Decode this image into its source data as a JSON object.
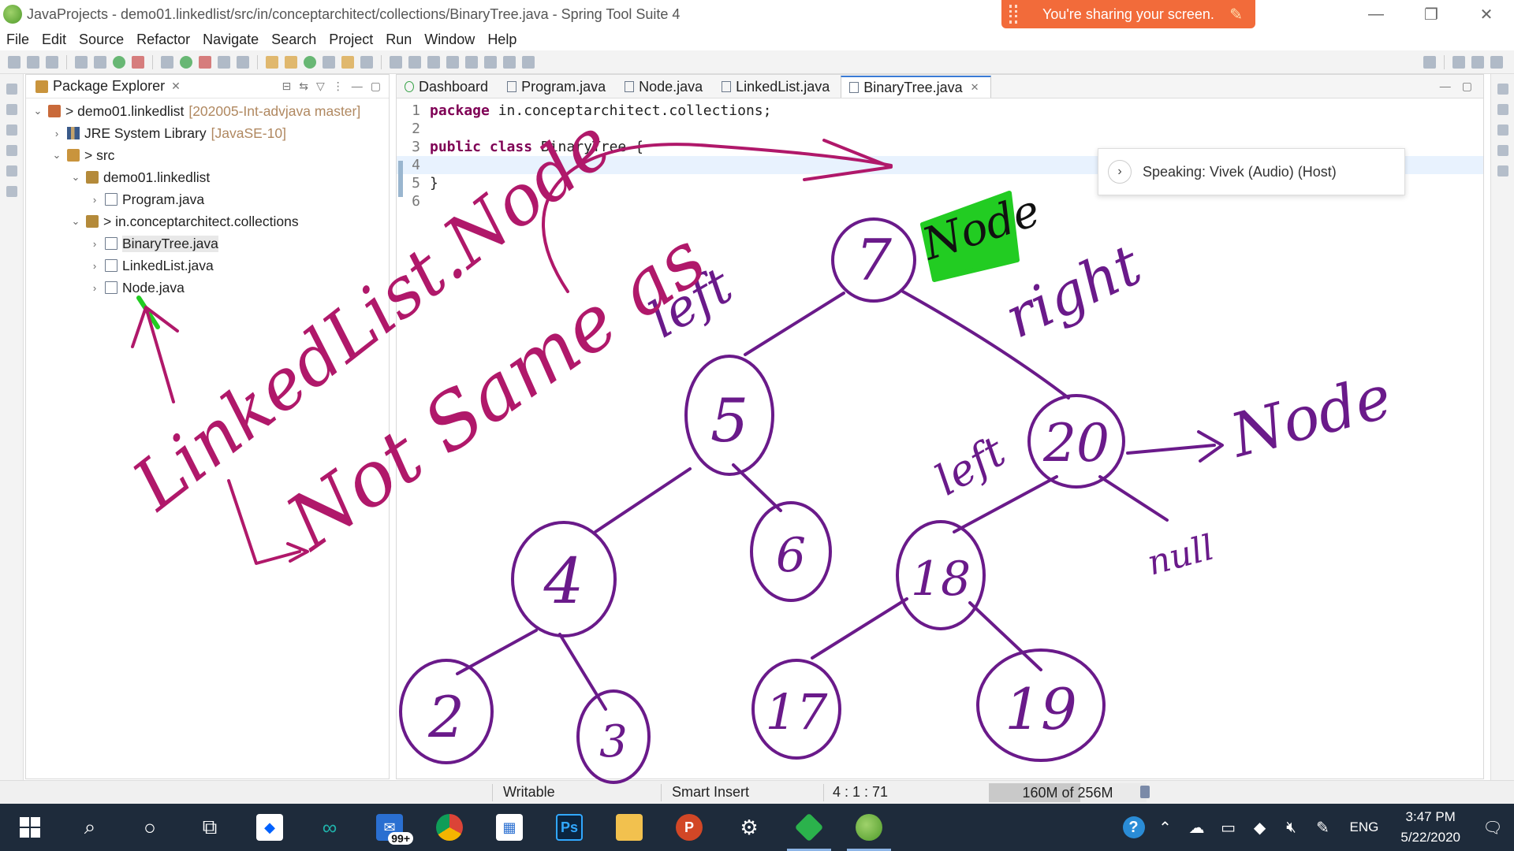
{
  "window": {
    "title": "JavaProjects - demo01.linkedlist/src/in/conceptarchitect/collections/BinaryTree.java - Spring Tool Suite 4",
    "share_banner": "You're sharing your screen."
  },
  "menu": [
    "File",
    "Edit",
    "Source",
    "Refactor",
    "Navigate",
    "Search",
    "Project",
    "Run",
    "Window",
    "Help"
  ],
  "explorer": {
    "title": "Package Explorer",
    "tree": [
      {
        "label": "demo01.linkedlist",
        "prefix": ">",
        "extra": "[202005-Int-advjava master]"
      },
      {
        "label": "JRE System Library",
        "extra": "[JavaSE-10]"
      },
      {
        "label": "src",
        "prefix": ">"
      },
      {
        "label": "demo01.linkedlist"
      },
      {
        "label": "Program.java"
      },
      {
        "label": "in.conceptarchitect.collections",
        "prefix": ">"
      },
      {
        "label": "BinaryTree.java"
      },
      {
        "label": "LinkedList.java"
      },
      {
        "label": "Node.java"
      }
    ]
  },
  "editor": {
    "tabs": [
      "Dashboard",
      "Program.java",
      "Node.java",
      "LinkedList.java",
      "BinaryTree.java"
    ],
    "active_tab": "BinaryTree.java",
    "lines": [
      {
        "n": "1",
        "kw": "package",
        "rest": " in.conceptarchitect.collections;"
      },
      {
        "n": "2",
        "kw": "",
        "rest": ""
      },
      {
        "n": "3",
        "kw": "public class",
        "rest": " BinaryTree {"
      },
      {
        "n": "4",
        "kw": "",
        "rest": ""
      },
      {
        "n": "5",
        "kw": "",
        "rest": "}"
      },
      {
        "n": "6",
        "kw": "",
        "rest": ""
      }
    ]
  },
  "speaking": "Speaking: Vivek (Audio) (Host)",
  "status": {
    "writable": "Writable",
    "insert_mode": "Smart Insert",
    "position": "4 : 1 : 71",
    "heap": "160M of 256M"
  },
  "taskbar": {
    "mail_badge": "99+",
    "language": "ENG",
    "time": "3:47 PM",
    "date": "5/22/2020"
  },
  "annotations": {
    "tree_nodes": [
      "7",
      "5",
      "20",
      "4",
      "6",
      "18",
      "2",
      "3",
      "17",
      "19"
    ],
    "labels": [
      "Node",
      "left",
      "right",
      "left",
      "Node",
      "null"
    ],
    "side_notes": [
      "LinkedList.Node",
      "Not Same as"
    ]
  },
  "colors": {
    "share_banner": "#f26b3a",
    "keyword": "#7f0055",
    "ink_tree": "#6a1a8a",
    "ink_notes": "#b0186a",
    "highlight": "#22cc22",
    "taskbar": "#1e2b3b"
  }
}
